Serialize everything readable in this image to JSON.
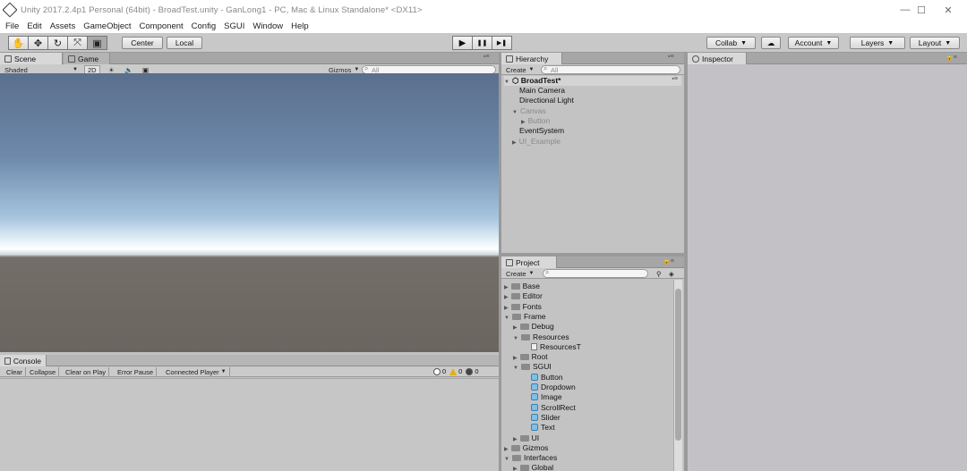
{
  "window": {
    "title": "Unity 2017.2.4p1 Personal (64bit) - BroadTest.unity - GanLong1 - PC, Mac & Linux Standalone* <DX11>",
    "minimize": "—",
    "maximize": "☐",
    "close": "✕"
  },
  "menu": [
    "File",
    "Edit",
    "Assets",
    "GameObject",
    "Component",
    "Config",
    "SGUI",
    "Window",
    "Help"
  ],
  "toolbar": {
    "tools": [
      "hand-tool",
      "move-tool",
      "rotate-tool",
      "scale-tool",
      "rect-tool"
    ],
    "tool_glyphs": [
      "✋",
      "✥",
      "↻",
      "⤧",
      "▣"
    ],
    "pivot": "Center",
    "space": "Local",
    "play": "▶",
    "pause": "❚❚",
    "step": "▶❚",
    "collab": "Collab",
    "cloud": "☁",
    "account": "Account",
    "layers": "Layers",
    "layout": "Layout"
  },
  "scene_panel": {
    "tabs": [
      "Scene",
      "Game"
    ],
    "shading": "Shaded",
    "mode_2d": "2D",
    "gizmos": "Gizmos",
    "search_placeholder": "All"
  },
  "hierarchy": {
    "tab": "Hierarchy",
    "create": "Create",
    "search_placeholder": "All",
    "scene": "BroadTest*",
    "items": [
      {
        "label": "Main Camera",
        "dim": false,
        "indent": 1,
        "arrow": ""
      },
      {
        "label": "Directional Light",
        "dim": false,
        "indent": 1,
        "arrow": ""
      },
      {
        "label": "Canvas",
        "dim": true,
        "indent": 1,
        "arrow": "▼"
      },
      {
        "label": "Button",
        "dim": true,
        "indent": 2,
        "arrow": "▶"
      },
      {
        "label": "EventSystem",
        "dim": false,
        "indent": 1,
        "arrow": ""
      },
      {
        "label": "UI_Example",
        "dim": true,
        "indent": 1,
        "arrow": "▶"
      }
    ]
  },
  "project": {
    "tab": "Project",
    "create": "Create",
    "items": [
      {
        "label": "Base",
        "indent": 0,
        "arrow": "▶",
        "kind": "folder"
      },
      {
        "label": "Editor",
        "indent": 0,
        "arrow": "▶",
        "kind": "folder"
      },
      {
        "label": "Fonts",
        "indent": 0,
        "arrow": "▶",
        "kind": "folder"
      },
      {
        "label": "Frame",
        "indent": 0,
        "arrow": "▼",
        "kind": "folder"
      },
      {
        "label": "Debug",
        "indent": 1,
        "arrow": "▶",
        "kind": "folder"
      },
      {
        "label": "Resources",
        "indent": 1,
        "arrow": "▼",
        "kind": "folder"
      },
      {
        "label": "ResourcesT",
        "indent": 2,
        "arrow": "",
        "kind": "file"
      },
      {
        "label": "Root",
        "indent": 1,
        "arrow": "▶",
        "kind": "folder"
      },
      {
        "label": "SGUI",
        "indent": 1,
        "arrow": "▼",
        "kind": "folder"
      },
      {
        "label": "Button",
        "indent": 2,
        "arrow": "",
        "kind": "prefab"
      },
      {
        "label": "Dropdown",
        "indent": 2,
        "arrow": "",
        "kind": "prefab"
      },
      {
        "label": "Image",
        "indent": 2,
        "arrow": "",
        "kind": "prefab"
      },
      {
        "label": "ScrollRect",
        "indent": 2,
        "arrow": "",
        "kind": "prefab"
      },
      {
        "label": "Slider",
        "indent": 2,
        "arrow": "",
        "kind": "prefab"
      },
      {
        "label": "Text",
        "indent": 2,
        "arrow": "",
        "kind": "prefab"
      },
      {
        "label": "UI",
        "indent": 1,
        "arrow": "▶",
        "kind": "folder"
      },
      {
        "label": "Gizmos",
        "indent": 0,
        "arrow": "▶",
        "kind": "folder"
      },
      {
        "label": "Interfaces",
        "indent": 0,
        "arrow": "▼",
        "kind": "folder"
      },
      {
        "label": "Global",
        "indent": 1,
        "arrow": "▶",
        "kind": "folder"
      }
    ]
  },
  "console": {
    "tab": "Console",
    "buttons": [
      "Clear",
      "Collapse",
      "Clear on Play",
      "Error Pause",
      "Connected Player"
    ],
    "info_count": "0",
    "warn_count": "0",
    "error_count": "0"
  },
  "inspector": {
    "tab": "Inspector"
  }
}
